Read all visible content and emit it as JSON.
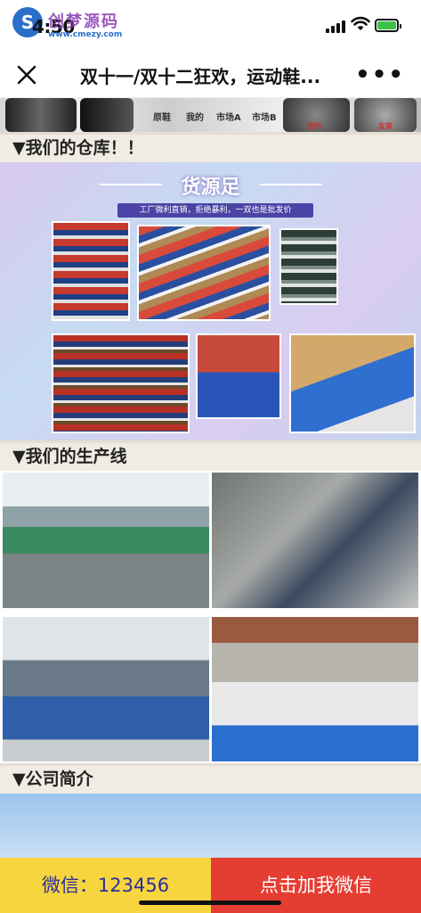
{
  "status": {
    "time": "4:50",
    "watermark_cn": "创梦源码",
    "watermark_url": "www.cmezy.com"
  },
  "nav": {
    "title": "双十一/双十二狂欢，运动鞋...",
    "more_label": "•••"
  },
  "strip_labels": [
    "原鞋",
    "我的",
    "市场A",
    "市场B",
    "我的",
    "友商"
  ],
  "sections": {
    "warehouse": "▼我们的仓库！！",
    "production": "▼我们的生产线",
    "about": "▼公司简介"
  },
  "warehouse_banner": {
    "title": "货源足",
    "subtitle": "工厂微利直销，拒绝暴利，一双也是批发价"
  },
  "footer": {
    "wechat_label": "微信：123456",
    "add_button": "点击加我微信"
  },
  "colors": {
    "footer_left_bg": "#f7d53f",
    "footer_right_bg": "#e63d33",
    "section_bg": "#f0ece4"
  }
}
